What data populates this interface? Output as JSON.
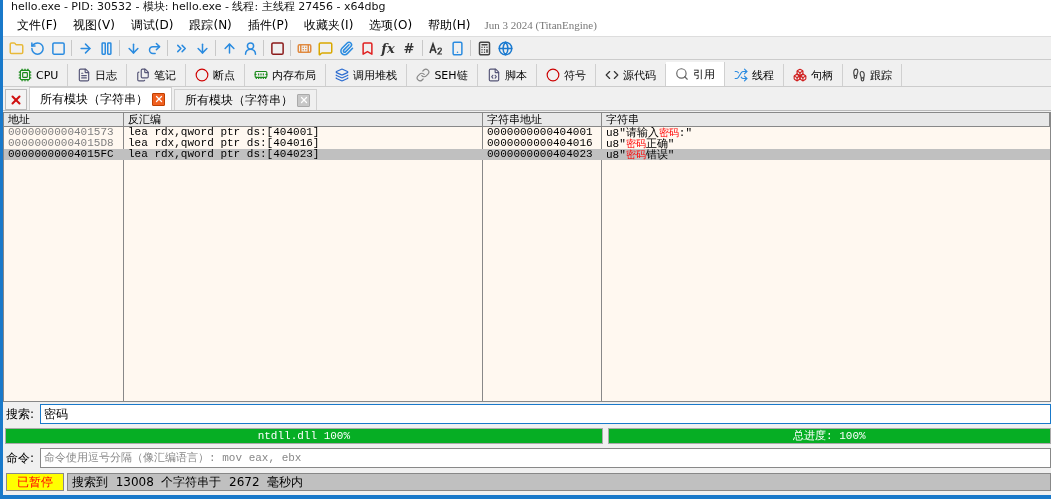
{
  "window": {
    "title": "hello.exe - PID: 30532 - 模块: hello.exe - 线程: 主线程 27456 - x64dbg"
  },
  "menu": {
    "items": [
      "文件(F)",
      "视图(V)",
      "调试(D)",
      "跟踪(N)",
      "插件(P)",
      "收藏夹(I)",
      "选项(O)",
      "帮助(H)"
    ],
    "build": "Jun 3 2024 (TitanEngine)"
  },
  "toolbar": {
    "glyphs": [
      "fx",
      "#"
    ]
  },
  "tabs": [
    {
      "label": "CPU",
      "selected": false
    },
    {
      "label": "日志",
      "selected": false
    },
    {
      "label": "笔记",
      "selected": false
    },
    {
      "label": "断点",
      "selected": false
    },
    {
      "label": "内存布局",
      "selected": false
    },
    {
      "label": "调用堆栈",
      "selected": false
    },
    {
      "label": "SEH链",
      "selected": false
    },
    {
      "label": "脚本",
      "selected": false
    },
    {
      "label": "符号",
      "selected": false
    },
    {
      "label": "源代码",
      "selected": false
    },
    {
      "label": "引用",
      "selected": true
    },
    {
      "label": "线程",
      "selected": false
    },
    {
      "label": "句柄",
      "selected": false
    },
    {
      "label": "跟踪",
      "selected": false
    }
  ],
  "reference_tabs": [
    {
      "label": "所有模块（字符串）",
      "selected": true
    },
    {
      "label": "所有模块（字符串）",
      "selected": false
    }
  ],
  "table": {
    "columns": [
      "地址",
      "反汇编",
      "字符串地址",
      "字符串"
    ],
    "rows": [
      {
        "address": "0000000000401573",
        "disassembly": "lea rdx,qword ptr ds:[404001]",
        "string_address": "0000000000404001",
        "string": [
          {
            "text": "u8\"请输入",
            "match": false
          },
          {
            "text": "密码",
            "match": true
          },
          {
            "text": ":\"",
            "match": false
          }
        ],
        "selected": false
      },
      {
        "address": "00000000004015D8",
        "disassembly": "lea rdx,qword ptr ds:[404016]",
        "string_address": "0000000000404016",
        "string": [
          {
            "text": "u8\"",
            "match": false
          },
          {
            "text": "密码",
            "match": true
          },
          {
            "text": "正确\"",
            "match": false
          }
        ],
        "selected": false
      },
      {
        "address": "00000000004015FC",
        "disassembly": "lea rdx,qword ptr ds:[404023]",
        "string_address": "0000000000404023",
        "string": [
          {
            "text": "u8\"",
            "match": false
          },
          {
            "text": "密码",
            "match": true
          },
          {
            "text": "错误\"",
            "match": false
          }
        ],
        "selected": true
      }
    ]
  },
  "search": {
    "label": "搜索:",
    "value": "密码"
  },
  "progress": [
    {
      "text": "ntdll.dll 100%",
      "level": 1
    },
    {
      "text": "总进度: 100%",
      "level": 1
    }
  ],
  "command": {
    "label": "命令:",
    "placeholder": "命令使用逗号分隔（像汇编语言）: mov eax, ebx"
  },
  "status_bar": {
    "state": "已暂停",
    "message": "搜索到  13008  个字符串于  2672  毫秒内"
  }
}
